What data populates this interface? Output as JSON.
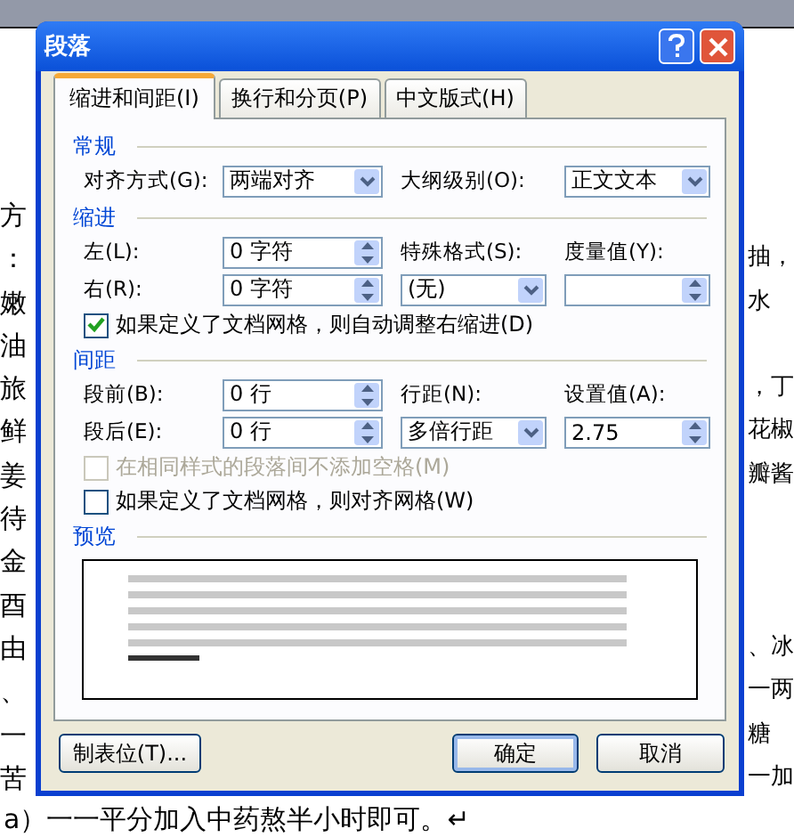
{
  "document": {
    "lines": [
      {
        "left": "方"
      },
      {
        "left": "：",
        "right": "抽，"
      },
      {
        "left": "嫩",
        "right": "水"
      },
      {
        "left": "油"
      },
      {
        "left": "旅",
        "right": "，丁"
      },
      {
        "left": "鲜",
        "right": "花椒"
      },
      {
        "left": "姜",
        "right": "瓣酱"
      },
      {
        "left": "待"
      },
      {
        "left": "金"
      },
      {
        "left": "酉"
      },
      {
        "left": "由",
        "right": "、冰"
      },
      {
        "left": "、",
        "right": "一两"
      },
      {
        "left": "一",
        "right": "糖"
      },
      {
        "left": "苦",
        "right": "一加"
      }
    ],
    "last_line": "a）一一平分加入中药熬半小时即可。↵"
  },
  "dialog": {
    "title": "段落",
    "tabs": [
      {
        "label": "缩进和间距(I)",
        "selected": true
      },
      {
        "label": "换行和分页(P)",
        "selected": false
      },
      {
        "label": "中文版式(H)",
        "selected": false
      }
    ],
    "sections": [
      {
        "heading": "常规",
        "rows": [
          {
            "kind": "fields",
            "items": [
              {
                "kind": "label",
                "text": "对齐方式(G):"
              },
              {
                "kind": "combo",
                "value": "两端对齐"
              },
              {
                "kind": "label",
                "text": "大纲级别(O):"
              },
              {
                "kind": "combo",
                "value": "正文文本"
              }
            ]
          }
        ]
      },
      {
        "heading": "缩进",
        "rows": [
          {
            "kind": "fields",
            "items": [
              {
                "kind": "label",
                "text": "左(L):"
              },
              {
                "kind": "spinner",
                "value": "0 字符"
              },
              {
                "kind": "label",
                "text": "特殊格式(S):"
              },
              {
                "kind": "label",
                "text": "度量值(Y):"
              }
            ]
          },
          {
            "kind": "fields",
            "items": [
              {
                "kind": "label",
                "text": "右(R):"
              },
              {
                "kind": "spinner",
                "value": "0 字符"
              },
              {
                "kind": "combo",
                "value": "(无)"
              },
              {
                "kind": "spinner"
              }
            ]
          },
          {
            "kind": "checkbox",
            "text": "如果定义了文档网格，则自动调整右缩进(D)",
            "checked": true,
            "disabled": false
          }
        ]
      },
      {
        "heading": "间距",
        "rows": [
          {
            "kind": "fields",
            "items": [
              {
                "kind": "label",
                "text": "段前(B):"
              },
              {
                "kind": "spinner",
                "value": "0 行"
              },
              {
                "kind": "label",
                "text": "行距(N):"
              },
              {
                "kind": "label",
                "text": "设置值(A):"
              }
            ]
          },
          {
            "kind": "fields",
            "items": [
              {
                "kind": "label",
                "text": "段后(E):"
              },
              {
                "kind": "spinner",
                "value": "0 行"
              },
              {
                "kind": "combo",
                "value": "多倍行距"
              },
              {
                "kind": "spinner",
                "value": "2.75"
              }
            ]
          },
          {
            "kind": "checkbox",
            "text": "在相同样式的段落间不添加空格(M)",
            "checked": false,
            "disabled": true
          },
          {
            "kind": "checkbox",
            "text": "如果定义了文档网格，则对齐网格(W)",
            "checked": false,
            "disabled": false
          }
        ]
      },
      {
        "heading": "预览",
        "rows": [
          {
            "kind": "preview"
          }
        ]
      }
    ],
    "buttons": [
      {
        "label": "制表位(T)...",
        "default": false
      },
      {
        "label": "确定",
        "default": true
      },
      {
        "label": "取消",
        "default": false
      }
    ]
  }
}
